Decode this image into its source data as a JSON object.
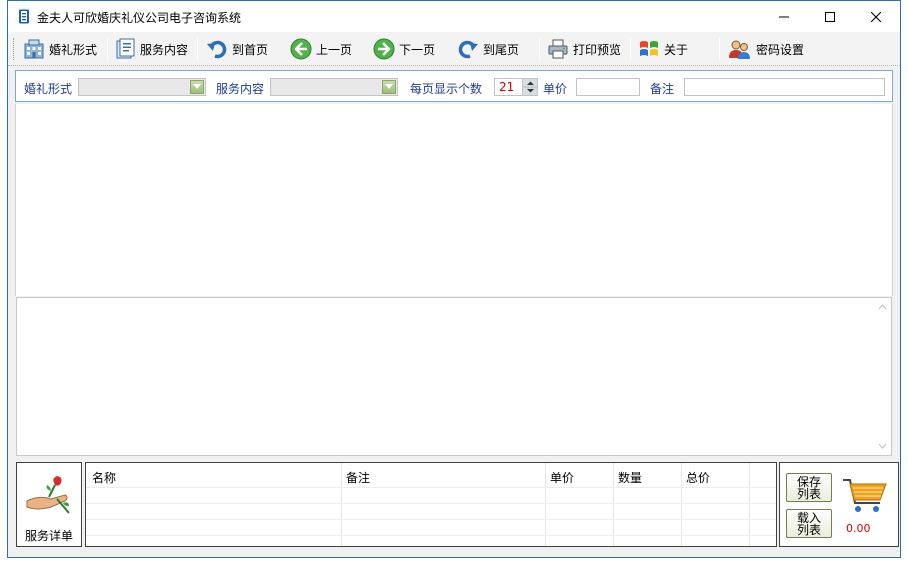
{
  "window": {
    "title": "金夫人可欣婚庆礼仪公司电子咨询系统",
    "icon": "app-book-icon"
  },
  "toolbar": {
    "items": [
      {
        "label": "婚礼形式",
        "icon": "building-icon"
      },
      {
        "label": "服务内容",
        "icon": "document-icon"
      },
      {
        "label": "到首页",
        "icon": "undo-arrow-icon"
      },
      {
        "label": "上一页",
        "icon": "arrow-left-circle-icon"
      },
      {
        "label": "下一页",
        "icon": "arrow-right-circle-icon"
      },
      {
        "label": "到尾页",
        "icon": "redo-arrow-icon"
      },
      {
        "label": "打印预览",
        "icon": "printer-icon"
      },
      {
        "label": "关于",
        "icon": "windows-logo-icon"
      },
      {
        "label": "密码设置",
        "icon": "users-icon"
      }
    ]
  },
  "filters": {
    "wedding_style_label": "婚礼形式",
    "wedding_style_value": "",
    "service_label": "服务内容",
    "service_value": "",
    "per_page_label": "每页显示个数",
    "per_page_value": "21",
    "price_label": "单价",
    "price_value": "",
    "note_label": "备注",
    "note_value": ""
  },
  "detail": {
    "label": "服务详单",
    "icon": "flower-hand-icon",
    "columns": [
      "名称",
      "备注",
      "单价",
      "数量",
      "总价"
    ]
  },
  "cart": {
    "save_label_1": "保存",
    "save_label_2": "列表",
    "load_label_1": "载入",
    "load_label_2": "列表",
    "icon": "shopping-cart-icon",
    "total": "0.00"
  },
  "colors": {
    "accent": "#2b6fb5",
    "label_blue": "#1e3d8f",
    "total_red": "#d40000"
  }
}
